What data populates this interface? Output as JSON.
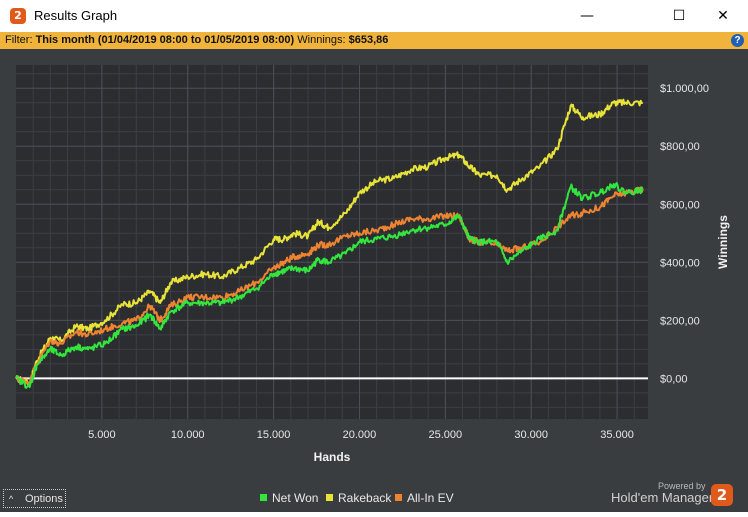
{
  "window": {
    "title": "Results Graph",
    "app_icon": "2",
    "minimize_glyph": "—",
    "maximize_glyph": "☐",
    "close_glyph": "✕"
  },
  "filter": {
    "label": "Filter:",
    "value": "This month (01/04/2019 08:00 to 01/05/2019 08:00)",
    "winnings_label": "Winnings:",
    "winnings_value": "$653,86",
    "help_glyph": "?"
  },
  "options": {
    "label": "Options",
    "caret": "^"
  },
  "branding": {
    "powered_by": "Powered by",
    "name": "Hold'em Manager",
    "logo": "2"
  },
  "chart_data": {
    "type": "line",
    "title": "",
    "xlabel": "Hands",
    "ylabel": "Winnings",
    "xlim": [
      0,
      36800
    ],
    "ylim": [
      -140,
      1080
    ],
    "x_ticks": [
      {
        "value": 5000,
        "label": "5.000"
      },
      {
        "value": 10000,
        "label": "10.000"
      },
      {
        "value": 15000,
        "label": "15.000"
      },
      {
        "value": 20000,
        "label": "20.000"
      },
      {
        "value": 25000,
        "label": "25.000"
      },
      {
        "value": 30000,
        "label": "30.000"
      },
      {
        "value": 35000,
        "label": "35.000"
      }
    ],
    "y_ticks": [
      {
        "value": 0,
        "label": "$0,00"
      },
      {
        "value": 200,
        "label": "$200,00"
      },
      {
        "value": 400,
        "label": "$400,00"
      },
      {
        "value": 600,
        "label": "$600,00"
      },
      {
        "value": 800,
        "label": "$800,00"
      },
      {
        "value": 1000,
        "label": "$1.000,00"
      }
    ],
    "grid": true,
    "zero_line": true,
    "legend_position": "bottom",
    "series": [
      {
        "name": "Rakeback",
        "color": "#e8e338",
        "x": [
          0,
          800,
          1200,
          2000,
          2600,
          3500,
          4200,
          5200,
          6200,
          7000,
          7800,
          8400,
          9000,
          10000,
          11000,
          12000,
          13000,
          14000,
          15000,
          15600,
          16200,
          17000,
          17600,
          18200,
          19200,
          20000,
          21000,
          22000,
          23000,
          24000,
          25000,
          25800,
          26400,
          27000,
          28000,
          28600,
          29500,
          30500,
          31500,
          32300,
          33000,
          34000,
          34800,
          35500,
          36500
        ],
        "y": [
          0,
          -15,
          60,
          140,
          130,
          180,
          170,
          200,
          255,
          260,
          300,
          260,
          330,
          350,
          360,
          350,
          380,
          410,
          480,
          480,
          500,
          490,
          540,
          520,
          570,
          640,
          680,
          690,
          720,
          730,
          760,
          770,
          730,
          700,
          700,
          650,
          690,
          730,
          790,
          940,
          900,
          910,
          950,
          950,
          950
        ]
      },
      {
        "name": "All-In EV",
        "color": "#ee8331",
        "x": [
          0,
          800,
          1200,
          2000,
          2600,
          3500,
          4200,
          5200,
          6200,
          7000,
          7800,
          8400,
          9000,
          10000,
          11000,
          12000,
          13000,
          14000,
          15000,
          15600,
          16200,
          17000,
          17600,
          18200,
          19200,
          20000,
          21000,
          22000,
          23000,
          24000,
          25000,
          25800,
          26400,
          27000,
          28000,
          28600,
          29500,
          30500,
          31500,
          32300,
          33000,
          34000,
          34800,
          35500,
          36500
        ],
        "y": [
          0,
          -15,
          50,
          130,
          120,
          160,
          150,
          170,
          190,
          200,
          250,
          200,
          250,
          280,
          280,
          280,
          300,
          330,
          380,
          400,
          420,
          430,
          460,
          460,
          490,
          500,
          510,
          530,
          550,
          550,
          560,
          560,
          480,
          470,
          460,
          440,
          450,
          470,
          520,
          560,
          570,
          590,
          630,
          640,
          650
        ]
      },
      {
        "name": "Net Won",
        "color": "#33e63e",
        "x": [
          0,
          800,
          1200,
          2000,
          2600,
          3500,
          4200,
          5200,
          6200,
          7000,
          7800,
          8400,
          9000,
          10000,
          11000,
          12000,
          13000,
          14000,
          15000,
          15600,
          16200,
          17000,
          17600,
          18200,
          19200,
          20000,
          21000,
          22000,
          23000,
          24000,
          25000,
          25800,
          26400,
          27000,
          28000,
          28600,
          29500,
          30500,
          31500,
          32300,
          33000,
          34000,
          34800,
          35500,
          36500
        ],
        "y": [
          0,
          -30,
          45,
          100,
          80,
          110,
          100,
          120,
          170,
          180,
          220,
          170,
          230,
          260,
          260,
          260,
          280,
          310,
          360,
          370,
          380,
          370,
          410,
          400,
          430,
          470,
          480,
          490,
          510,
          520,
          530,
          560,
          480,
          470,
          470,
          400,
          440,
          480,
          510,
          660,
          620,
          640,
          670,
          640,
          650
        ]
      }
    ]
  }
}
